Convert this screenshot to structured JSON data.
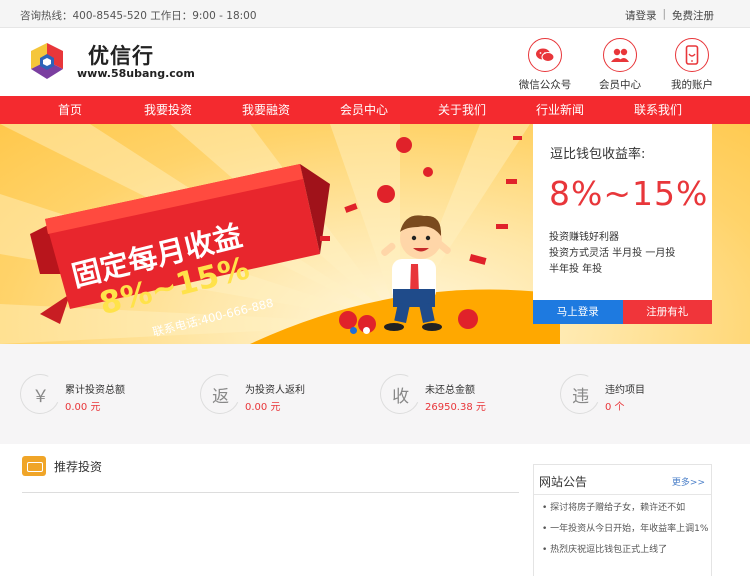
{
  "topbar": {
    "hotline": "咨询热线：400-8545-520 工作日：9:00 - 18:00",
    "login": "请登录",
    "separator": "|",
    "register": "免费注册"
  },
  "brand": {
    "name": "优信行",
    "url": "www.58ubang.com",
    "colors": {
      "red": "#e8363a",
      "purple": "#7b3fa0",
      "yellow": "#f5c63a",
      "blue": "#2d63b8"
    }
  },
  "header_links": [
    {
      "label": "微信公众号",
      "icon": "wechat-icon"
    },
    {
      "label": "会员中心",
      "icon": "members-icon"
    },
    {
      "label": "我的账户",
      "icon": "phone-account-icon"
    }
  ],
  "nav": [
    "首页",
    "我要投资",
    "我要融资",
    "会员中心",
    "关于我们",
    "行业新闻",
    "联系我们"
  ],
  "banner": {
    "headline": "固定每月收益",
    "rate": "8%~15%",
    "phone": "联系电话:400-666-888",
    "slides": 2,
    "active_slide": 1
  },
  "panel": {
    "title": "逗比钱包收益率:",
    "rate": "8%~15%",
    "line1": "投资赚钱好利器",
    "line2": "投资方式灵活 半月投 一月投",
    "line3": "半年投 年投",
    "login_button": "马上登录",
    "register_button": "注册有礼"
  },
  "stats": [
    {
      "glyph": "￥",
      "label": "累计投资总额",
      "value": "0.00 元"
    },
    {
      "glyph": "返",
      "label": "为投资人返利",
      "value": "0.00 元"
    },
    {
      "glyph": "收",
      "label": "未还总金额",
      "value": "26950.38 元"
    },
    {
      "glyph": "违",
      "label": "违约项目",
      "value": "0 个"
    }
  ],
  "recommend": {
    "title": "推荐投资"
  },
  "notice": {
    "title": "网站公告",
    "more": "更多>>",
    "items": [
      "探讨将房子赠给子女，赖许还不如",
      "一年投资从今日开始，年收益率上调1%",
      "热烈庆祝逗比钱包正式上线了"
    ]
  }
}
